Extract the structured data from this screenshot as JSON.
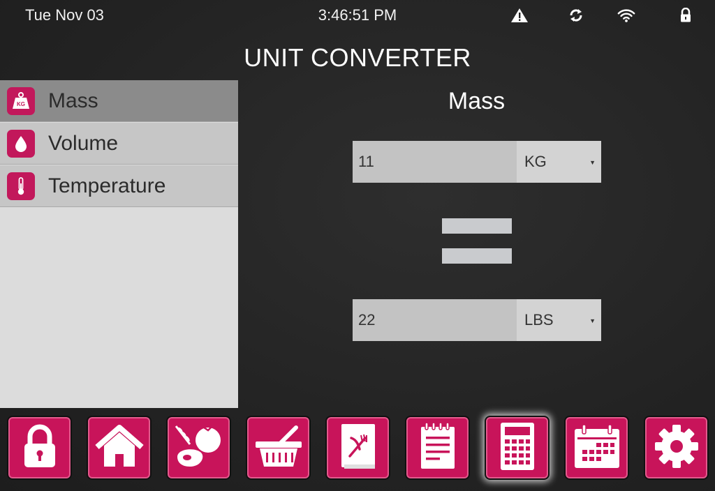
{
  "status": {
    "date": "Tue Nov 03",
    "time": "3:46:51 PM",
    "icons": [
      "warning-icon",
      "sync-icon",
      "wifi-icon",
      "lock-icon"
    ]
  },
  "title": "UNIT CONVERTER",
  "sidebar": {
    "items": [
      {
        "label": "Mass",
        "icon": "kg-weight-icon",
        "active": true
      },
      {
        "label": "Volume",
        "icon": "droplet-icon",
        "active": false
      },
      {
        "label": "Temperature",
        "icon": "thermometer-icon",
        "active": false
      }
    ]
  },
  "main": {
    "title": "Mass",
    "from": {
      "value": "11",
      "unit": "KG"
    },
    "to": {
      "value": "22",
      "unit": "LBS"
    }
  },
  "dock": {
    "items": [
      {
        "icon": "lock-icon",
        "active": false
      },
      {
        "icon": "home-icon",
        "active": false
      },
      {
        "icon": "food-icon",
        "active": false
      },
      {
        "icon": "basket-icon",
        "active": false
      },
      {
        "icon": "recipe-book-icon",
        "active": false
      },
      {
        "icon": "notepad-icon",
        "active": false
      },
      {
        "icon": "calculator-icon",
        "active": true
      },
      {
        "icon": "calendar-icon",
        "active": false
      },
      {
        "icon": "settings-gear-icon",
        "active": false
      }
    ]
  },
  "colors": {
    "accent": "#c8145a",
    "sidebar_bg": "#dcdcdc",
    "sidebar_item": "#c6c6c6",
    "sidebar_active": "#8b8b8b",
    "background": "#262626"
  },
  "kg_badge": "KG"
}
